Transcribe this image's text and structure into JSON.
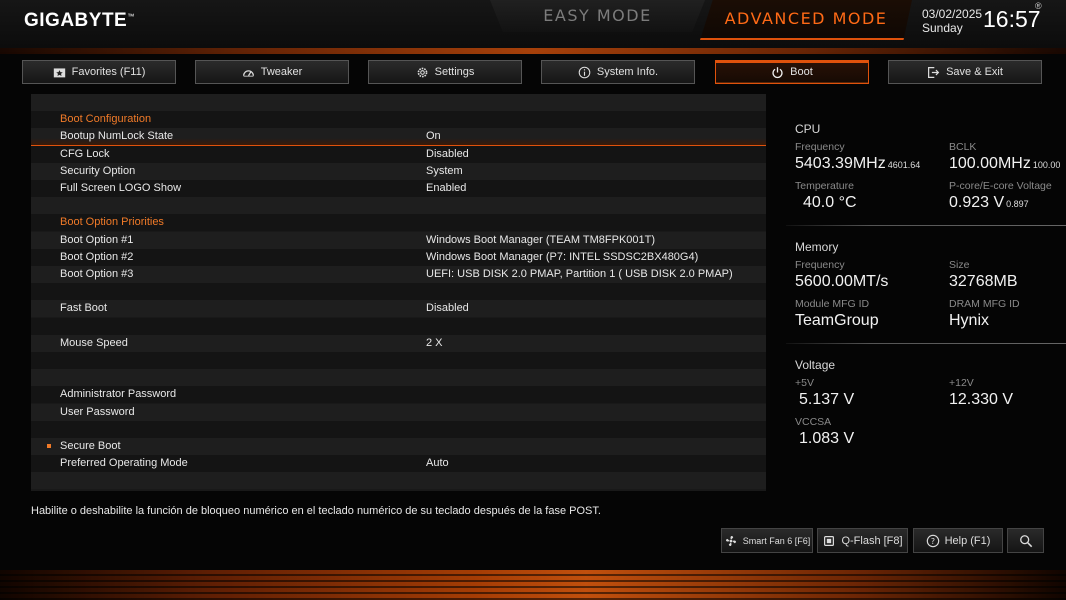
{
  "header": {
    "logo": "GIGABYTE",
    "logo_mark": "™",
    "easy_mode": "EASY MODE",
    "advanced_mode": "ADVANCED MODE",
    "date": "03/02/2025",
    "day": "Sunday",
    "time": "16:57",
    "registered_mark": "®"
  },
  "tabs": [
    {
      "label": "Favorites (F11)",
      "icon": "star-folder-icon"
    },
    {
      "label": "Tweaker",
      "icon": "gauge-icon"
    },
    {
      "label": "Settings",
      "icon": "gear-icon"
    },
    {
      "label": "System Info.",
      "icon": "info-icon"
    },
    {
      "label": "Boot",
      "icon": "power-icon",
      "active": true
    },
    {
      "label": "Save & Exit",
      "icon": "exit-icon"
    }
  ],
  "rows": [
    {
      "label": "",
      "value": ""
    },
    {
      "label": "Boot Configuration",
      "value": "",
      "section": true
    },
    {
      "label": "Bootup NumLock State",
      "value": "On",
      "selected": true
    },
    {
      "label": "CFG Lock",
      "value": "Disabled"
    },
    {
      "label": "Security Option",
      "value": "System"
    },
    {
      "label": "Full Screen LOGO Show",
      "value": "Enabled"
    },
    {
      "label": "",
      "value": ""
    },
    {
      "label": "Boot Option Priorities",
      "value": "",
      "section": true
    },
    {
      "label": "Boot Option #1",
      "value": "Windows Boot Manager (TEAM TM8FPK001T)"
    },
    {
      "label": "Boot Option #2",
      "value": "Windows Boot Manager (P7: INTEL SSDSC2BX480G4)"
    },
    {
      "label": "Boot Option #3",
      "value": "UEFI:  USB DISK 2.0 PMAP, Partition 1 ( USB DISK 2.0 PMAP)"
    },
    {
      "label": "",
      "value": ""
    },
    {
      "label": "Fast Boot",
      "value": "Disabled"
    },
    {
      "label": "",
      "value": ""
    },
    {
      "label": "Mouse Speed",
      "value": "2 X"
    },
    {
      "label": "",
      "value": ""
    },
    {
      "label": "",
      "value": ""
    },
    {
      "label": "Administrator Password",
      "value": ""
    },
    {
      "label": "User Password",
      "value": ""
    },
    {
      "label": "",
      "value": ""
    },
    {
      "label": "Secure Boot",
      "value": "",
      "bullet": true
    },
    {
      "label": "Preferred Operating Mode",
      "value": "Auto"
    },
    {
      "label": "",
      "value": ""
    }
  ],
  "help_text": "Habilite o deshabilite la función de bloqueo numérico en el teclado numérico de su teclado después de la fase POST.",
  "cpu": {
    "title": "CPU",
    "frequency_label": "Frequency",
    "frequency": "5403.39MHz",
    "frequency_small": "4601.64",
    "bclk_label": "BCLK",
    "bclk": "100.00MHz",
    "bclk_small": "100.00",
    "temp_label": "Temperature",
    "temp": "40.0 °C",
    "voltage_label": "P-core/E-core Voltage",
    "voltage": "0.923 V",
    "voltage_small": "0.897"
  },
  "memory": {
    "title": "Memory",
    "frequency_label": "Frequency",
    "frequency": "5600.00MT/s",
    "size_label": "Size",
    "size": "32768MB",
    "module_label": "Module MFG ID",
    "module": "TeamGroup",
    "dram_label": "DRAM MFG ID",
    "dram": "Hynix"
  },
  "voltage": {
    "title": "Voltage",
    "v5_label": "+5V",
    "v5": "5.137 V",
    "v12_label": "+12V",
    "v12": "12.330 V",
    "vccsa_label": "VCCSA",
    "vccsa": "1.083 V"
  },
  "bottom_buttons": {
    "smartfan": "Smart Fan 6 [F6]",
    "qflash": "Q-Flash [F8]",
    "help": "Help (F1)"
  },
  "colors": {
    "accent": "#e0520c",
    "section": "#f07a28"
  }
}
